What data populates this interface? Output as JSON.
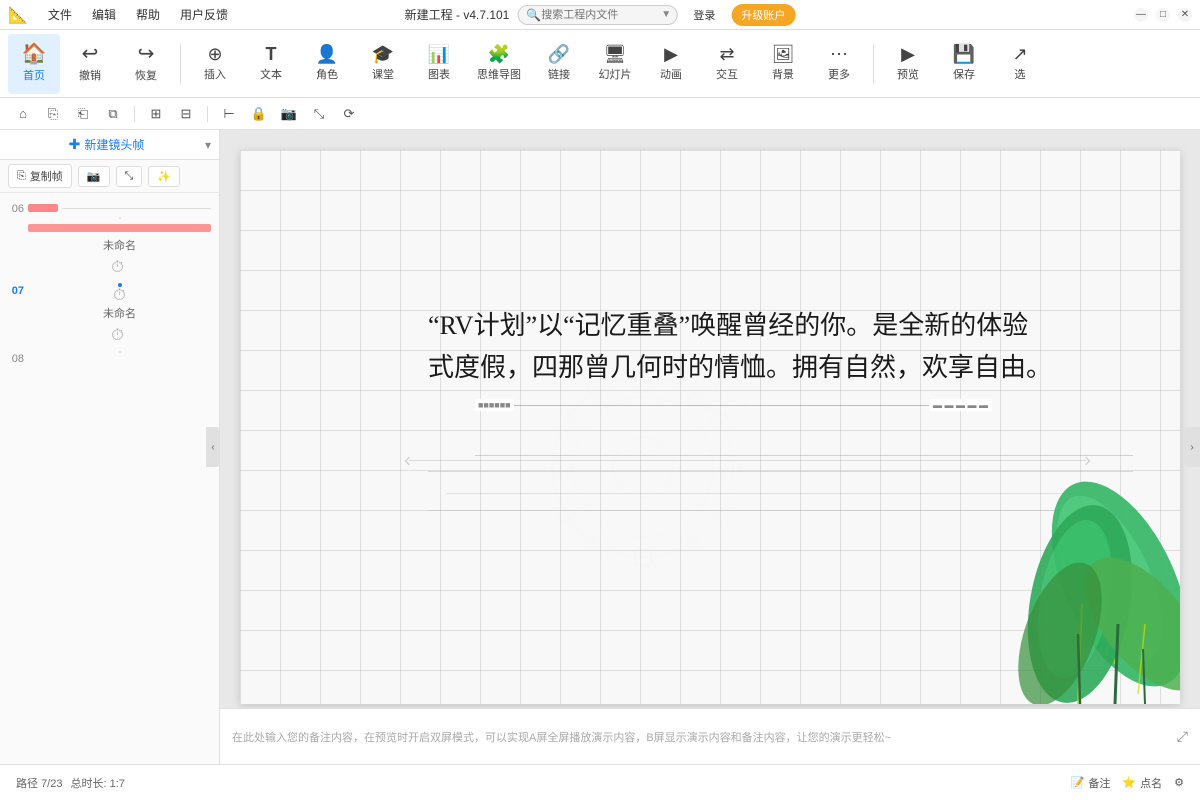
{
  "titlebar": {
    "menu": [
      "文件",
      "编辑",
      "帮助",
      "用户反馈"
    ],
    "title": "新建工程 - v4.7.101",
    "search_placeholder": "搜索工程内文件",
    "login_label": "登录",
    "upgrade_label": "升级账户",
    "win_min": "—",
    "win_max": "□",
    "win_close": "✕"
  },
  "toolbar": {
    "items": [
      {
        "id": "home",
        "icon": "🏠",
        "label": "首页"
      },
      {
        "id": "undo",
        "icon": "↩",
        "label": "撤销"
      },
      {
        "id": "redo",
        "icon": "↪",
        "label": "恢复"
      },
      {
        "id": "insert",
        "icon": "⊕",
        "label": "插入"
      },
      {
        "id": "text",
        "icon": "T",
        "label": "文本"
      },
      {
        "id": "character",
        "icon": "👤",
        "label": "角色"
      },
      {
        "id": "class",
        "icon": "🎓",
        "label": "课堂"
      },
      {
        "id": "chart",
        "icon": "📊",
        "label": "图表"
      },
      {
        "id": "mindmap",
        "icon": "🧩",
        "label": "思维导图"
      },
      {
        "id": "link",
        "icon": "🔗",
        "label": "链接"
      },
      {
        "id": "slides",
        "icon": "🖥",
        "label": "幻灯片"
      },
      {
        "id": "animation",
        "icon": "▶",
        "label": "动画"
      },
      {
        "id": "interact",
        "icon": "⇄",
        "label": "交互"
      },
      {
        "id": "background",
        "icon": "🖼",
        "label": "背景"
      },
      {
        "id": "more",
        "icon": "⋯",
        "label": "更多"
      },
      {
        "id": "preview",
        "icon": "▶",
        "label": "预览"
      },
      {
        "id": "save",
        "icon": "💾",
        "label": "保存"
      },
      {
        "id": "select",
        "icon": "↗",
        "label": "选"
      }
    ]
  },
  "subtoolbar": {
    "buttons": [
      "⌂",
      "⎘",
      "⎗",
      "⧉",
      "⊞",
      "⊟",
      "⊕",
      "⊖",
      "⊢",
      "🔒",
      "📷",
      "⤡",
      "⟳"
    ]
  },
  "panel": {
    "new_frame_label": "新建镜头帧",
    "copy_frame_label": "复制帧",
    "slides": [
      {
        "num": "06",
        "name": "未命名",
        "active": false,
        "content_type": "06"
      },
      {
        "num": "07",
        "name": "未命名",
        "active": true,
        "content_type": "07"
      },
      {
        "num": "08",
        "name": "",
        "active": false,
        "content_type": "08"
      }
    ]
  },
  "canvas": {
    "main_text_line1": "“RV计划”以“记忆重叠”唤醒曾经的你。是全新的体验",
    "main_text_line2": "式度假，四那曾几何时的情恤。拥有自然，欢享自由。",
    "slide_counter": "07/23",
    "notes_placeholder": "在此处输入您的备注内容，在预览时开启双屏模式，可以实现A屏全屏播放演示内容，B屏显示演示内容和备注内容，让您的演示更轻松~"
  },
  "statusbar": {
    "path_label": "路径 7/23",
    "total_label": "总时长: 1:7",
    "note_label": "备注",
    "star_label": "点名",
    "settings_icon": "⚙"
  },
  "colors": {
    "accent": "#1a7ee8",
    "upgrade_bg": "#f5a623",
    "active_slide_border": "#1a7ee8",
    "plant_green": "#4caf50",
    "plant_yellow": "#c8e000"
  }
}
